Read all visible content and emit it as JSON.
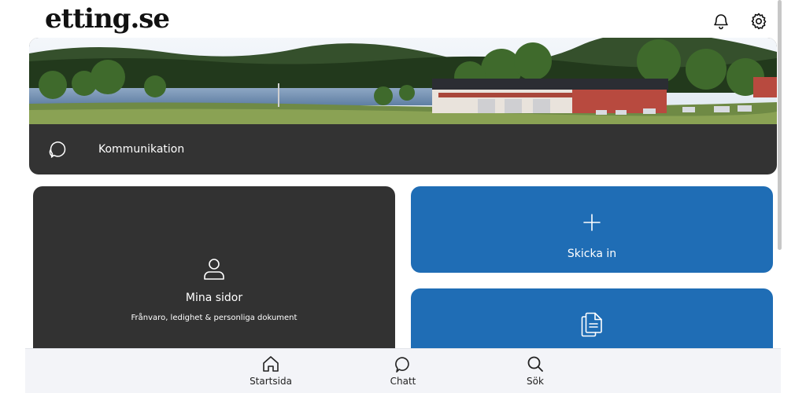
{
  "header": {
    "logo_text": "etting.se",
    "notifications_icon": "bell-icon",
    "settings_icon": "gear-icon"
  },
  "hero": {
    "image": "landscape-photo-lake-and-buildings",
    "section_icon": "chat-bubble-icon",
    "section_label": "Kommunikation"
  },
  "tiles": {
    "mina_sidor": {
      "icon": "user-icon",
      "title": "Mina sidor",
      "subtitle": "Frånvaro, ledighet & personliga dokument"
    },
    "skicka_in": {
      "icon": "plus-icon",
      "title": "Skicka in"
    },
    "documents": {
      "icon": "documents-icon"
    }
  },
  "bottom_nav": {
    "items": [
      {
        "label": "Startsida",
        "icon": "home-icon"
      },
      {
        "label": "Chatt",
        "icon": "chat-icon"
      },
      {
        "label": "Sök",
        "icon": "search-icon"
      }
    ]
  },
  "colors": {
    "dark_tile": "#323232",
    "blue_tile": "#1f6db5",
    "nav_background": "#f3f4f8"
  }
}
